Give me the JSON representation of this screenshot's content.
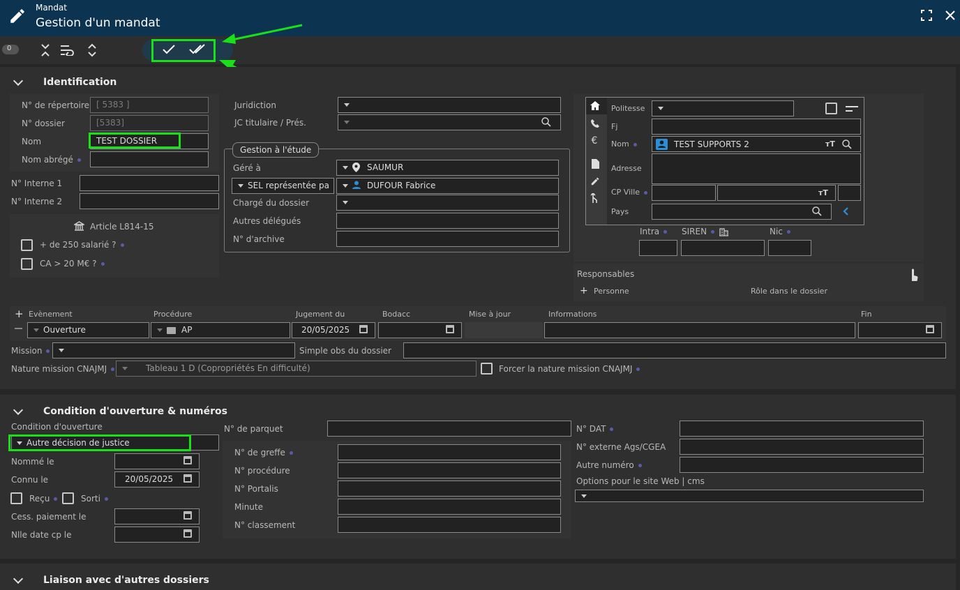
{
  "header": {
    "app": "Mandat",
    "title": "Gestion d'un mandat"
  },
  "toolbar": {
    "badge": "0"
  },
  "identification": {
    "section": "Identification",
    "repertoire_label": "N° de répertoire",
    "repertoire_value": "[ 5383 ]",
    "dossier_label": "N° dossier",
    "dossier_value": "[5383]",
    "nom_label": "Nom",
    "nom_value": "TEST DOSSIER",
    "nom_abrege_label": "Nom abrégé",
    "interne1_label": "N° Interne 1",
    "interne2_label": "N° Interne 2",
    "article_label": "Article L814-15",
    "salaries_label": "+ de 250 salarié ?",
    "ca_label": "CA > 20 M€ ?",
    "juridiction_label": "Juridiction",
    "jc_label": "JC titulaire / Prés.",
    "gestion_legend": "Gestion à l'étude",
    "gere_label": "Géré à",
    "gere_value": "SAUMUR",
    "sel_value": "SEL représentée pa",
    "sel_person": "DUFOUR Fabrice",
    "charge_label": "Chargé du dossier",
    "delegues_label": "Autres délégués",
    "archive_label": "N° d'archive"
  },
  "client": {
    "politesse_label": "Politesse",
    "fj_label": "Fj",
    "nom_label": "Nom",
    "nom_value": "TEST SUPPORTS 2",
    "adresse_label": "Adresse",
    "cpville_label": "CP Ville",
    "pays_label": "Pays",
    "intra_label": "Intra",
    "siren_label": "SIREN",
    "nic_label": "Nic",
    "responsables_label": "Responsables",
    "personne_label": "Personne",
    "role_label": "Rôle dans le dossier"
  },
  "evenements": {
    "columns": [
      "Evènement",
      "Procédure",
      "Jugement du",
      "Bodacc",
      "Mise à jour",
      "Informations",
      "Fin"
    ],
    "row": {
      "evenement": "Ouverture",
      "procedure": "AP",
      "jugement": "20/05/2025"
    },
    "mission_label": "Mission",
    "simple_obs_label": "Simple obs du dossier",
    "nature_label": "Nature mission CNAJMJ",
    "nature_value": "Tableau 1 D (Copropriétés En difficulté)",
    "forcer_label": "Forcer la nature mission CNAJMJ"
  },
  "condition": {
    "section": "Condition d'ouverture & numéros",
    "cond_label": "Condition d'ouverture",
    "cond_value": "Autre décision de justice",
    "nomme_label": "Nommé le",
    "connu_label": "Connu le",
    "connu_value": "20/05/2025",
    "recu_label": "Reçu",
    "sorti_label": "Sorti",
    "cess_label": "Cess. paiement le",
    "nlle_label": "Nlle date cp le",
    "parquet_label": "N° de parquet",
    "greffe_label": "N° de greffe",
    "procedure_label": "N° procédure",
    "portalis_label": "N° Portalis",
    "minute_label": "Minute",
    "classement_label": "N° classement",
    "dat_label": "N° DAT",
    "ags_label": "N° externe Ags/CGEA",
    "autre_label": "Autre numéro",
    "options_label": "Options pour le site Web | cms"
  },
  "liaison": {
    "section": "Liaison avec d'autres dossiers"
  },
  "colors": {
    "header_bg": "#0c3450",
    "highlight": "#19e019",
    "accent": "#2a8fd8"
  }
}
